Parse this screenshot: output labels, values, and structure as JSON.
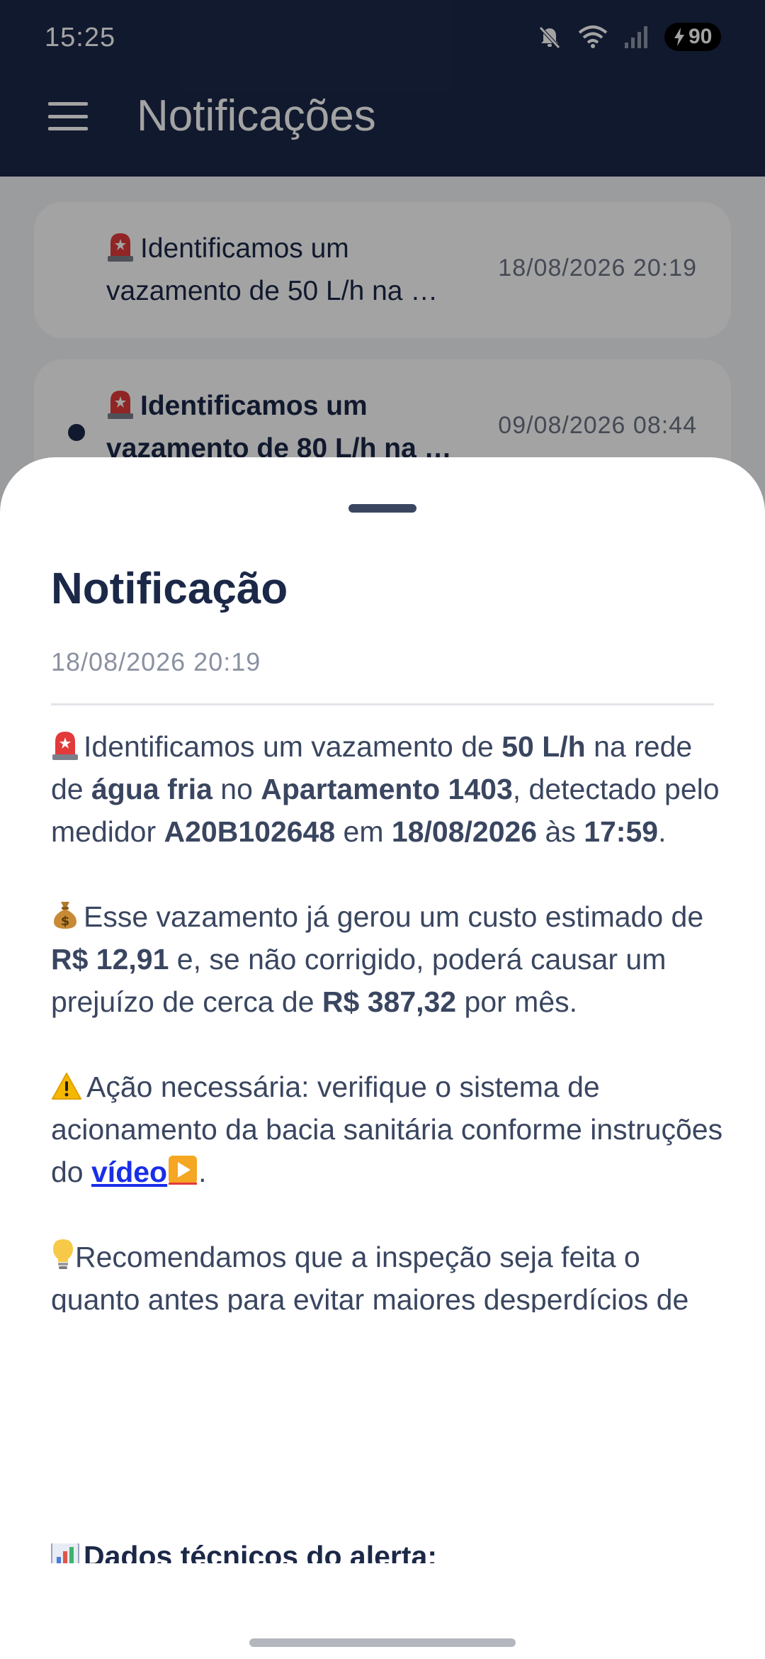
{
  "status_bar": {
    "time": "15:25",
    "battery": "90",
    "icons": [
      "mute-icon",
      "wifi-icon",
      "signal-icon",
      "battery-charging-icon"
    ]
  },
  "header": {
    "title": "Notificações",
    "menu_icon": "hamburger-menu-icon",
    "background_color": "#1b2848"
  },
  "notifications": [
    {
      "line1": "Identificamos um",
      "line2": "vazamento de 50 L/h na …",
      "date": "18/08/2026 20:19",
      "unread": false
    },
    {
      "line1": "Identificamos um",
      "line2": "vazamento de 80 L/h na …",
      "date": "09/08/2026 08:44",
      "unread": true
    }
  ],
  "sheet": {
    "title": "Notificação",
    "date": "18/08/2026 20:19",
    "p1": {
      "t1": "Identificamos um vazamento de ",
      "b1": "50 L/h",
      "t2": " na rede de ",
      "b2": "água fria",
      "t3": " no ",
      "b3": "Apartamento 1403",
      "t4": ", detectado pelo medidor ",
      "b4": "A20B102648",
      "t5": " em ",
      "b5": "18/08/2026",
      "t6": " às ",
      "b6": "17:59",
      "t7": "."
    },
    "p2": {
      "t1": "Esse vazamento já gerou um custo estimado de ",
      "b1": "R$ 12,91",
      "t2": " e, se não corrigido, poderá causar um prejuízo de cerca de ",
      "b2": "R$ 387,32",
      "t3": " por mês."
    },
    "p3": {
      "t1": "Ação necessária: verifique o sistema de acionamento da bacia sanitária conforme instruções do ",
      "link": "vídeo",
      "t2": "."
    },
    "p4": {
      "t1": "Recomendamos que a inspeção seja feita o quanto antes para evitar maiores desperdícios de água."
    },
    "tech_heading": "Dados técnicos do alerta:"
  },
  "colors": {
    "accent_dark": "#1b2848",
    "link": "#1a2ee8",
    "muted_text": "#8a91a1"
  }
}
